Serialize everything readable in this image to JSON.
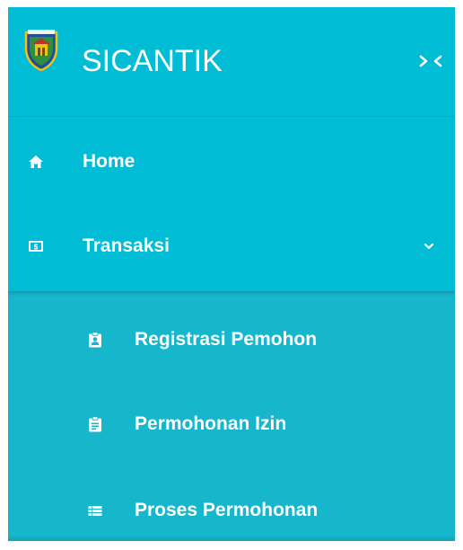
{
  "brand": {
    "title": "SICANTIK",
    "logo_icon": "shield-crest-icon",
    "toggle_icon": "collapse-arrows-icon"
  },
  "menu": {
    "items": [
      {
        "label": "Home",
        "icon": "home-icon"
      },
      {
        "label": "Transaksi",
        "icon": "money-icon",
        "expanded": true
      }
    ]
  },
  "submenu": {
    "items": [
      {
        "label": "Registrasi Pemohon",
        "icon": "clipboard-user-icon"
      },
      {
        "label": "Permohonan Izin",
        "icon": "clipboard-text-icon"
      },
      {
        "label": "Proses Permohonan",
        "icon": "list-icon"
      }
    ]
  },
  "colors": {
    "sidebar": "#00bcd4",
    "submenu": "#16b6cc",
    "text": "#ffffff"
  }
}
